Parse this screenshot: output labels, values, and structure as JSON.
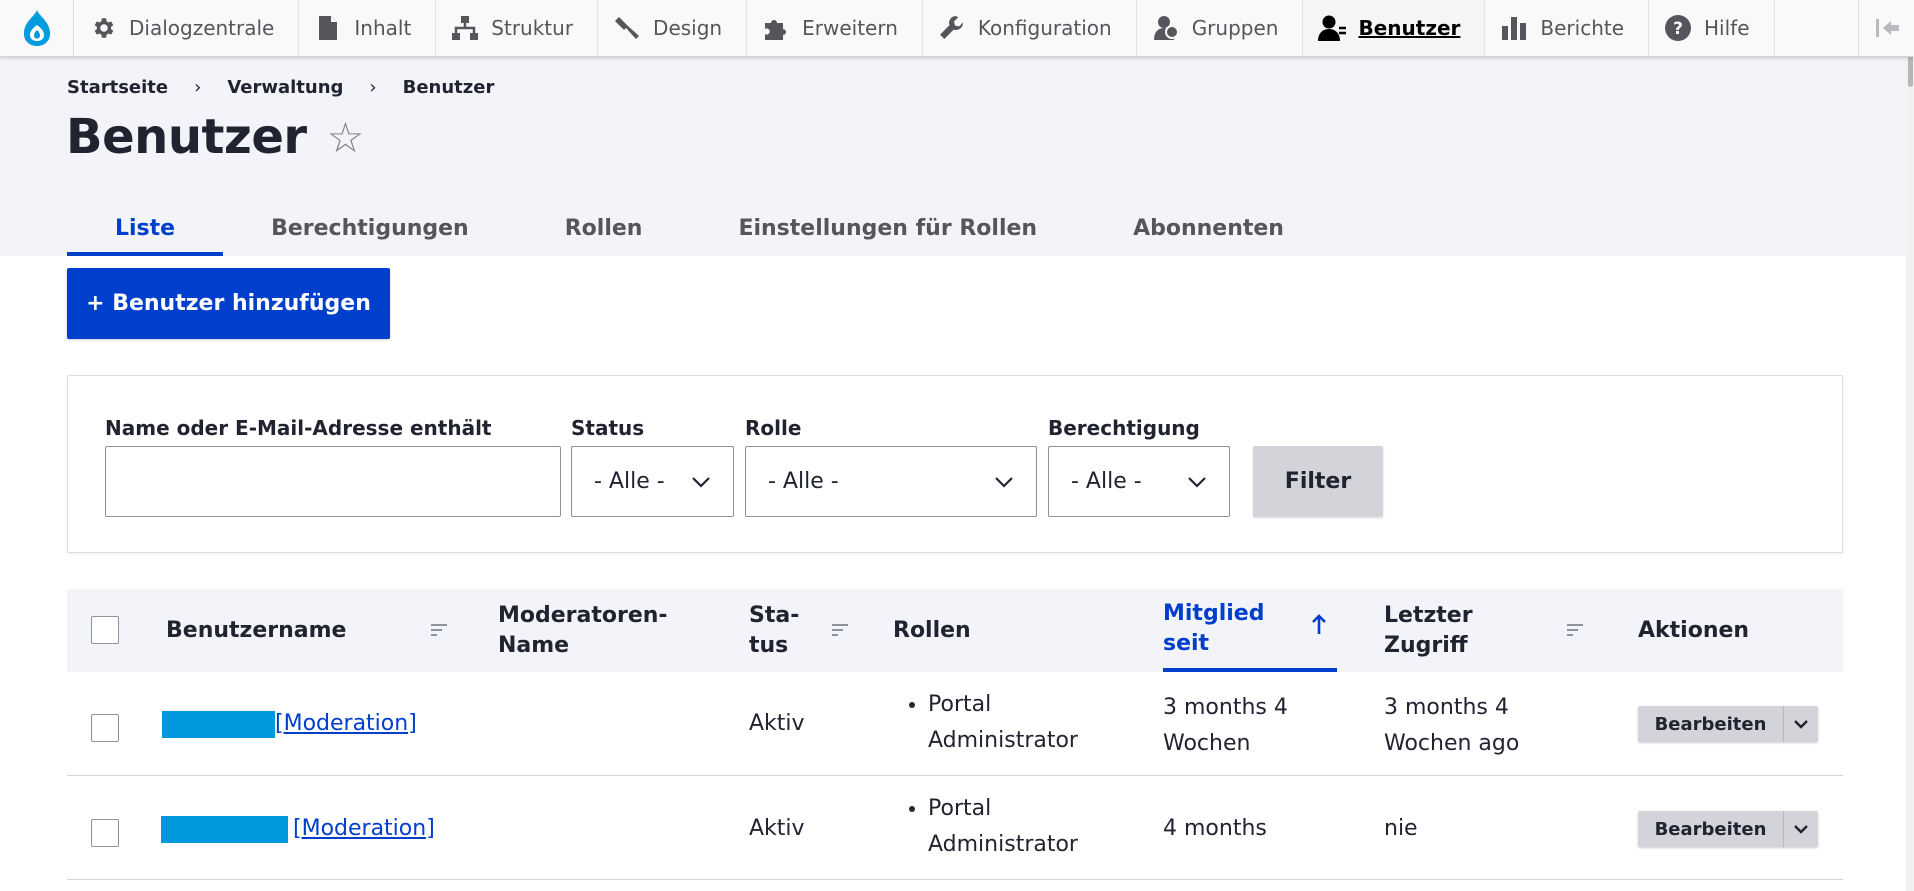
{
  "toolbar": {
    "items": [
      {
        "label": "Dialogzentrale",
        "icon": "gear-icon"
      },
      {
        "label": "Inhalt",
        "icon": "document-icon"
      },
      {
        "label": "Struktur",
        "icon": "sitemap-icon"
      },
      {
        "label": "Design",
        "icon": "paintbrush-icon"
      },
      {
        "label": "Erweitern",
        "icon": "puzzle-icon"
      },
      {
        "label": "Konfiguration",
        "icon": "wrench-icon"
      },
      {
        "label": "Gruppen",
        "icon": "group-icon"
      },
      {
        "label": "Benutzer",
        "icon": "user-icon",
        "active": true
      },
      {
        "label": "Berichte",
        "icon": "bar-chart-icon"
      },
      {
        "label": "Hilfe",
        "icon": "help-icon"
      }
    ]
  },
  "breadcrumb": [
    "Startseite",
    "Verwaltung",
    "Benutzer"
  ],
  "page": {
    "title": "Benutzer"
  },
  "tabs": [
    "Liste",
    "Berechtigungen",
    "Rollen",
    "Einstellungen für Rollen",
    "Abonnenten"
  ],
  "actions": {
    "add_user": "+ Benutzer hinzufügen"
  },
  "filters": {
    "name_label": "Name oder E-Mail-Adresse enthält",
    "name_value": "",
    "status_label": "Status",
    "status_value": "- Alle -",
    "role_label": "Rolle",
    "role_value": "- Alle -",
    "permission_label": "Berechtigung",
    "permission_value": "- Alle -",
    "submit": "Filter"
  },
  "table": {
    "headers": {
      "username": "Benutzername",
      "moderator_name_1": "Moderatoren-",
      "moderator_name_2": "Name",
      "status_1": "Sta-",
      "status_2": "tus",
      "roles": "Rollen",
      "member_since_1": "Mitglied",
      "member_since_2": "seit",
      "last_access": "Letzter Zugriff",
      "actions": "Aktionen"
    },
    "rows": [
      {
        "link": "[Moderation]",
        "status": "Aktiv",
        "role_1": "Portal",
        "role_2": "Administrator",
        "member_since_1": "3 months 4",
        "member_since_2": "Wochen",
        "last_access_1": "3 months 4",
        "last_access_2": "Wochen ago",
        "edit": "Bearbeiten"
      },
      {
        "link": "[Moderation]",
        "status": "Aktiv",
        "role_1": "Portal",
        "role_2": "Administrator",
        "member_since": "4 months",
        "last_access": "nie",
        "edit": "Bearbeiten"
      }
    ]
  },
  "colors": {
    "accent": "#003ecc",
    "redaction": "#0099de",
    "header_bg": "#f3f4f9"
  }
}
